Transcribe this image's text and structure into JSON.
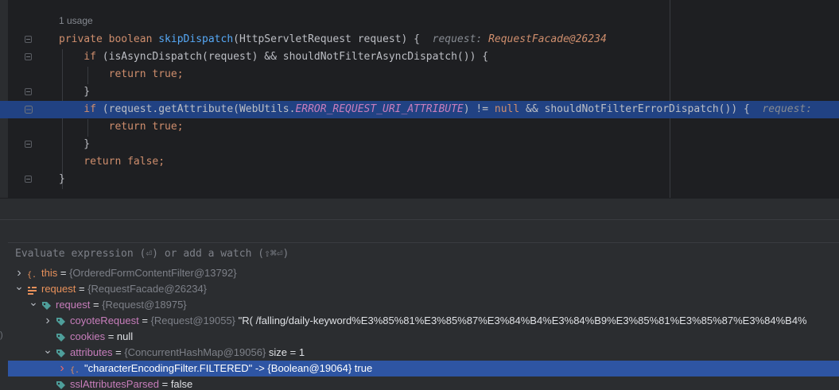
{
  "editor": {
    "usage_hint": "1 usage",
    "lines": [
      {
        "segments": [
          {
            "t": "private boolean ",
            "c": "kw"
          },
          {
            "t": "skipDispatch",
            "c": "fn"
          },
          {
            "t": "(HttpServletRequest request) {",
            "c": "plain"
          },
          {
            "t": "  request: ",
            "c": "hint"
          },
          {
            "t": "RequestFacade@26234",
            "c": "hintv"
          }
        ]
      },
      {
        "segments": [
          {
            "t": "    if ",
            "c": "kw"
          },
          {
            "t": "(isAsyncDispatch(request) && shouldNotFilterAsyncDispatch()) {",
            "c": "plain"
          }
        ]
      },
      {
        "segments": [
          {
            "t": "        return true;",
            "c": "kw"
          }
        ]
      },
      {
        "segments": [
          {
            "t": "    }",
            "c": "plain"
          }
        ]
      },
      {
        "segments": [
          {
            "t": "    if ",
            "c": "kw"
          },
          {
            "t": "(request.getAttribute(WebUtils.",
            "c": "plain"
          },
          {
            "t": "ERROR_REQUEST_URI_ATTRIBUTE",
            "c": "const"
          },
          {
            "t": ") != ",
            "c": "plain"
          },
          {
            "t": "null",
            "c": "kw"
          },
          {
            "t": " && shouldNotFilterErrorDispatch()) {",
            "c": "plain"
          },
          {
            "t": "  request: ",
            "c": "hint"
          }
        ]
      },
      {
        "segments": [
          {
            "t": "        return true;",
            "c": "kw"
          }
        ]
      },
      {
        "segments": [
          {
            "t": "    }",
            "c": "plain"
          }
        ]
      },
      {
        "segments": [
          {
            "t": "    return false;",
            "c": "kw"
          }
        ]
      },
      {
        "segments": [
          {
            "t": "}",
            "c": "plain"
          }
        ]
      }
    ]
  },
  "evaluate": {
    "placeholder": "Evaluate expression (⏎) or add a watch (⇧⌘⏎)"
  },
  "variables": [
    {
      "name": "this",
      "value": "{OrderedFormContentFilter@13792}",
      "extra": "",
      "icon": "object-icon",
      "arrow": "collapsed",
      "indent": 0,
      "nameColor": "orange"
    },
    {
      "name": "request",
      "value": "{RequestFacade@26234}",
      "extra": "",
      "icon": "parameter-icon",
      "arrow": "expanded",
      "indent": 0,
      "nameColor": "orange"
    },
    {
      "name": "request",
      "value": "{Request@18975}",
      "extra": "",
      "icon": "field-icon",
      "arrow": "expanded",
      "indent": 1,
      "nameColor": "purple"
    },
    {
      "name": "coyoteRequest",
      "value": "{Request@19055}",
      "extra": "\"R( /falling/daily-keyword%E3%85%81%E3%85%87%E3%84%B4%E3%84%B9%E3%85%81%E3%85%87%E3%84%B4%",
      "icon": "field-icon",
      "arrow": "collapsed",
      "indent": 2,
      "nameColor": "purple"
    },
    {
      "name": "cookies",
      "value": "",
      "extra": "= null",
      "icon": "field-icon",
      "arrow": "none",
      "indent": 2,
      "nameColor": "purple"
    },
    {
      "name": "attributes",
      "value": "{ConcurrentHashMap@19056}",
      "extra": " size = 1",
      "icon": "field-icon",
      "arrow": "expanded",
      "indent": 2,
      "nameColor": "purple"
    },
    {
      "name": "\"characterEncodingFilter.FILTERED\" -> {Boolean@19064} true",
      "value": "",
      "extra": "",
      "icon": "entry-icon",
      "arrow": "collapsed",
      "indent": 3,
      "nameColor": "sel",
      "selected": true
    },
    {
      "name": "sslAttributesParsed",
      "value": "",
      "extra": "= false",
      "icon": "field-icon",
      "arrow": "none",
      "indent": 2,
      "nameColor": "purple"
    }
  ],
  "left_bar_glyph": ")"
}
